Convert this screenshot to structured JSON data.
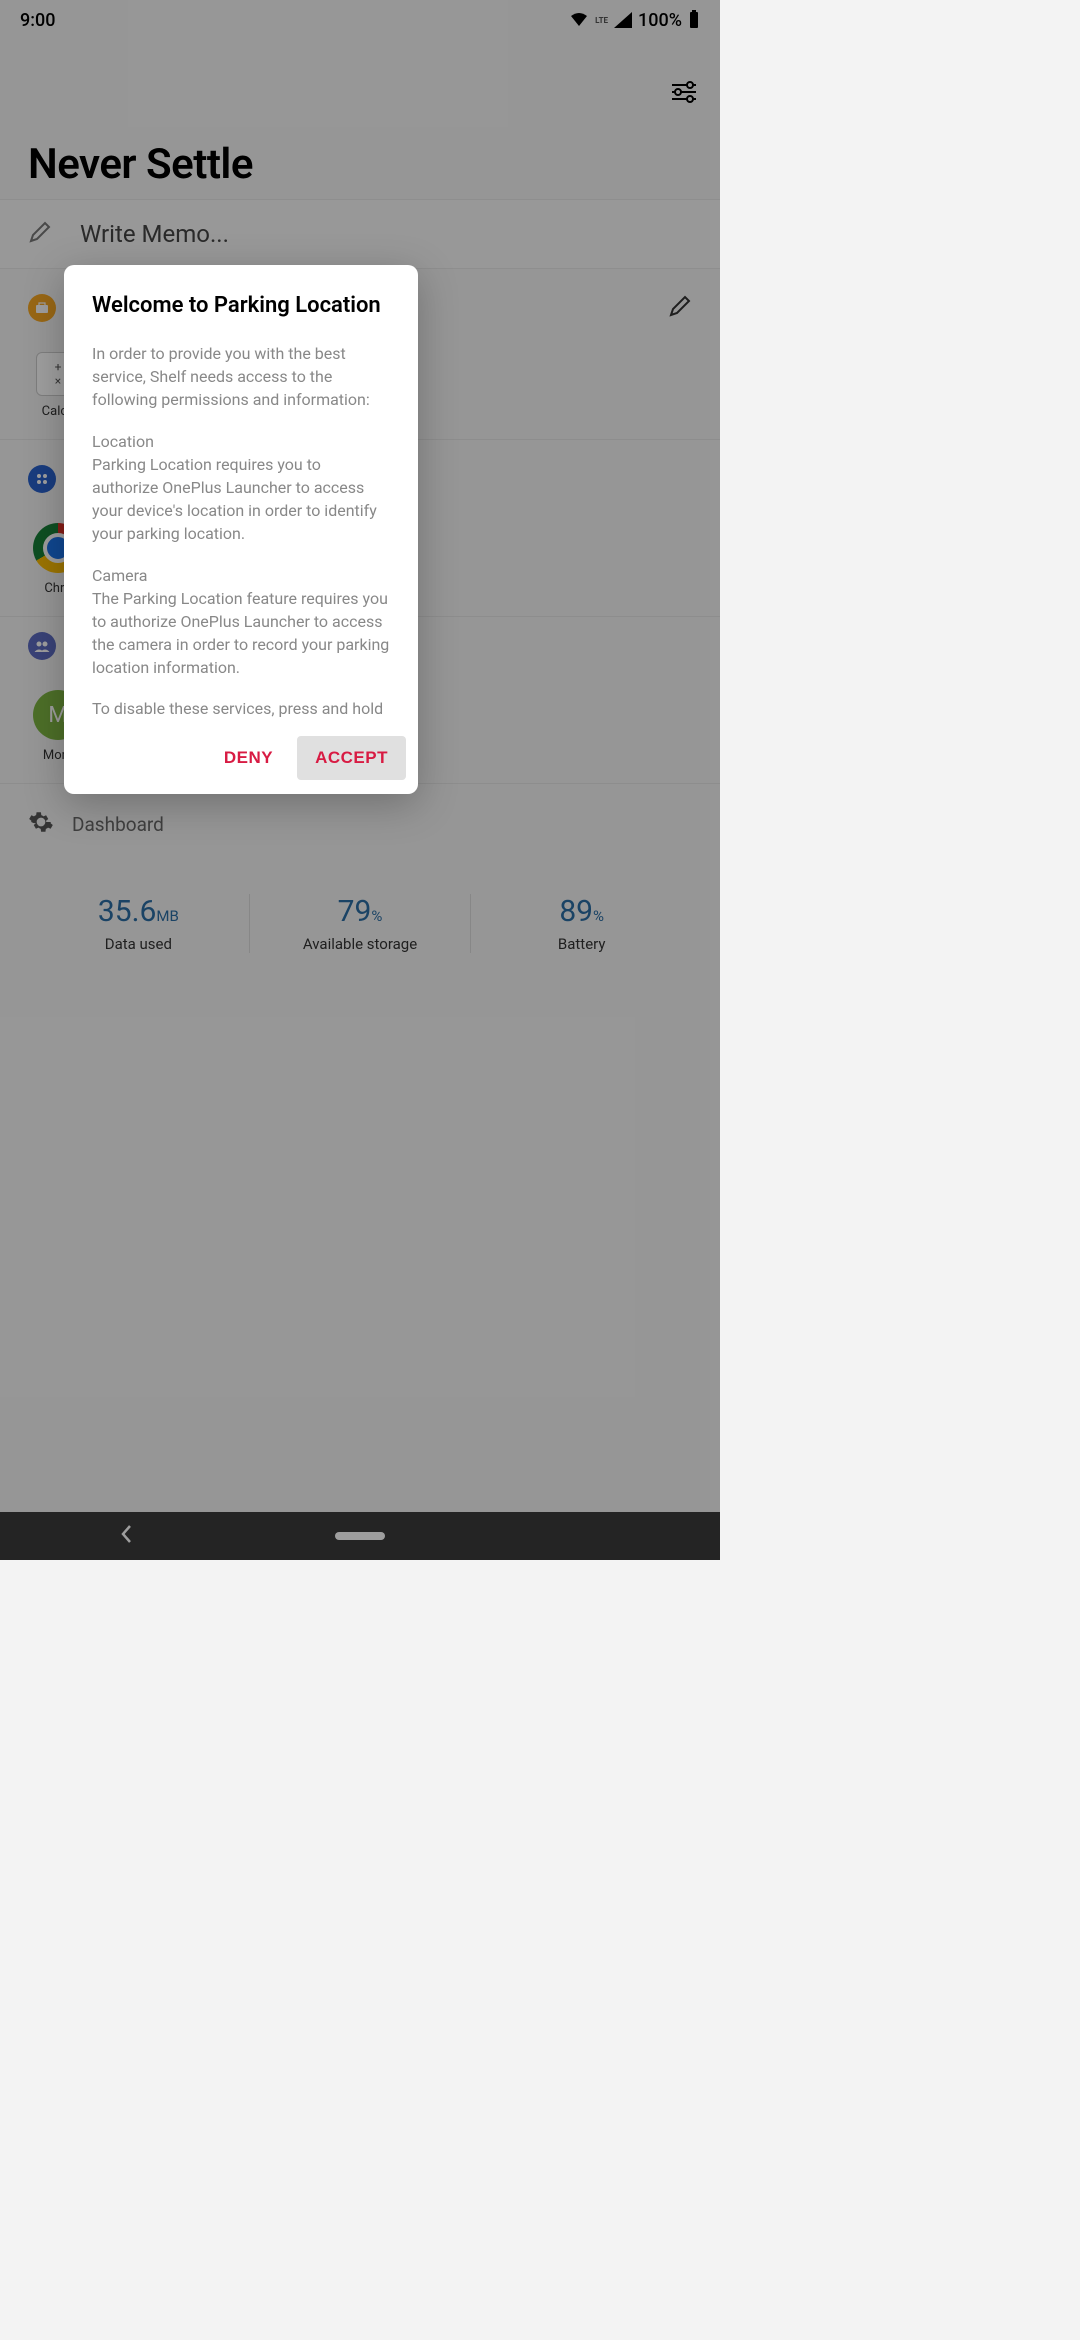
{
  "status": {
    "time": "9:00",
    "battery_pct": "100%",
    "net_label": "LTE"
  },
  "header": {
    "title": "Never Settle"
  },
  "memo": {
    "placeholder": "Write Memo..."
  },
  "toolbox": {
    "items": [
      {
        "label": "Calcu"
      }
    ]
  },
  "apps": {
    "items": [
      {
        "label": "Chro"
      }
    ]
  },
  "contacts": {
    "items": [
      {
        "initial": "M",
        "label": "Mom"
      }
    ]
  },
  "dashboard": {
    "title": "Dashboard",
    "stats": [
      {
        "value": "35.6",
        "unit": "MB",
        "label": "Data used"
      },
      {
        "value": "79",
        "unit": "%",
        "label": "Available storage"
      },
      {
        "value": "89",
        "unit": "%",
        "label": "Battery"
      }
    ]
  },
  "dialog": {
    "title": "Welcome to Parking Location",
    "intro": "In order to provide you with the best service, Shelf needs access to the following permissions and information:",
    "loc_head": "Location",
    "loc_body": "Parking Location requires you to authorize OnePlus Launcher to access your device's location in order to identify your parking location.",
    "cam_head": "Camera",
    "cam_body": "The Parking Location feature requires you to authorize OnePlus Launcher to access the camera in order to record your parking location information.",
    "disable": "To disable these services, press and hold the card on the Shelf page and tap the Disable button in the top right corner. Alternatively, go to the Shelf settings",
    "deny": "DENY",
    "accept": "ACCEPT"
  }
}
